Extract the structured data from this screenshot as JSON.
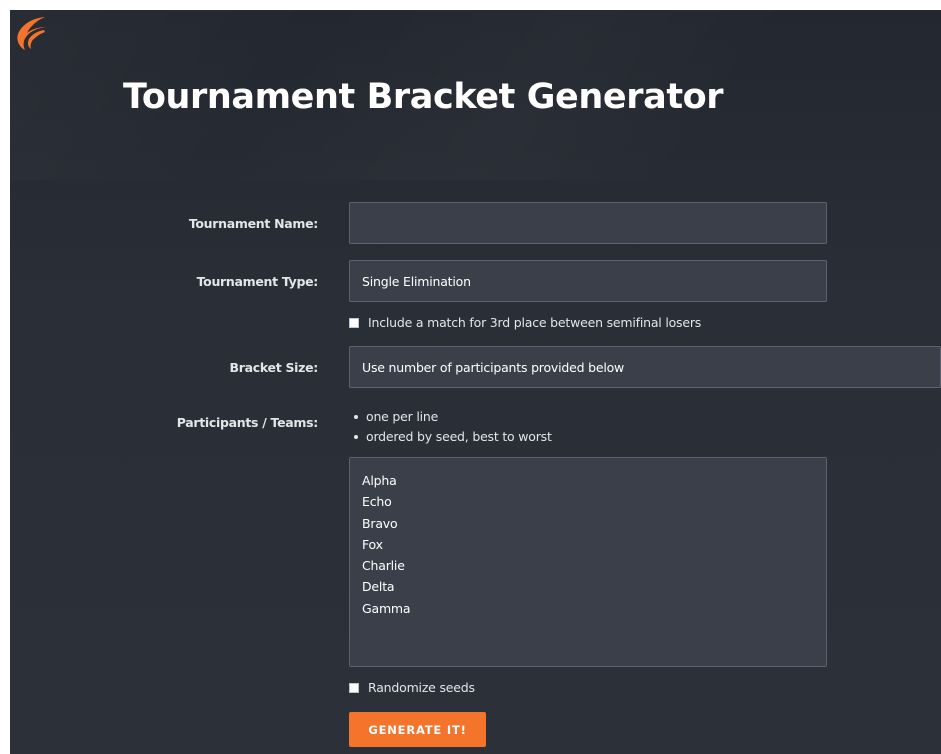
{
  "brand": {
    "logo_icon": "challonge-wing-logo-icon",
    "accent_color": "#f4742b"
  },
  "header": {
    "title": "Tournament Bracket Generator"
  },
  "form": {
    "tournament_name": {
      "label": "Tournament Name:",
      "value": ""
    },
    "tournament_type": {
      "label": "Tournament Type:",
      "selected": "Single Elimination"
    },
    "third_place": {
      "label": "Include a match for 3rd place between semifinal losers",
      "checked": false
    },
    "bracket_size": {
      "label": "Bracket Size:",
      "selected": "Use number of participants provided below"
    },
    "participants": {
      "label": "Participants / Teams:",
      "hints": [
        "one per line",
        "ordered by seed, best to worst"
      ],
      "entries": [
        "Alpha",
        "Echo",
        "Bravo",
        "Fox",
        "Charlie",
        "Delta",
        "Gamma"
      ]
    },
    "randomize": {
      "label": "Randomize seeds",
      "checked": false
    },
    "submit_label": "GENERATE IT!"
  },
  "colors": {
    "page_background": "#2a2e36",
    "field_background": "#3a3f4a",
    "field_border": "#5c6270",
    "button_background": "#f4742b"
  }
}
